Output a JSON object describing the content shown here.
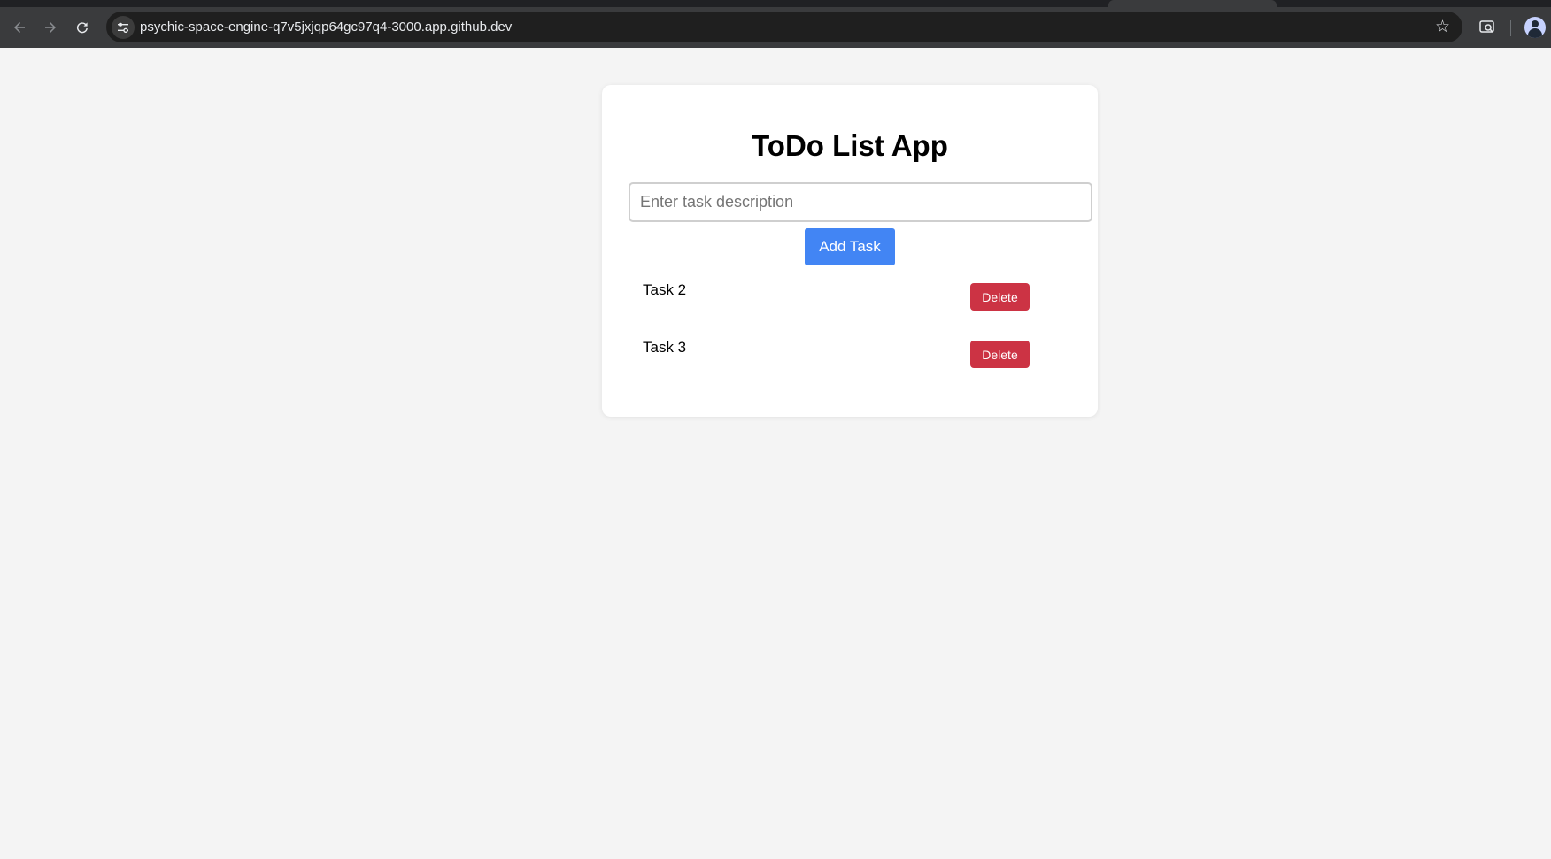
{
  "browser": {
    "url": "psychic-space-engine-q7v5jxjqp64gc97q4-3000.app.github.dev",
    "icons": {
      "back": "arrow-left-icon",
      "forward": "arrow-right-icon",
      "reload": "reload-icon",
      "site_info": "tune-icon",
      "bookmark": "star-icon",
      "lens": "search-lens-icon",
      "profile": "avatar"
    }
  },
  "app": {
    "title": "ToDo List App",
    "input": {
      "placeholder": "Enter task description",
      "value": ""
    },
    "add_button_label": "Add Task",
    "tasks": [
      {
        "label": "Task 2",
        "delete_label": "Delete"
      },
      {
        "label": "Task 3",
        "delete_label": "Delete"
      }
    ]
  },
  "colors": {
    "page_background": "#f4f4f4",
    "card_background": "#ffffff",
    "add_button": "#4285f4",
    "delete_button": "#cc3344",
    "browser_toolbar": "#3a3b3d",
    "omnibox": "#1f1f1f"
  }
}
